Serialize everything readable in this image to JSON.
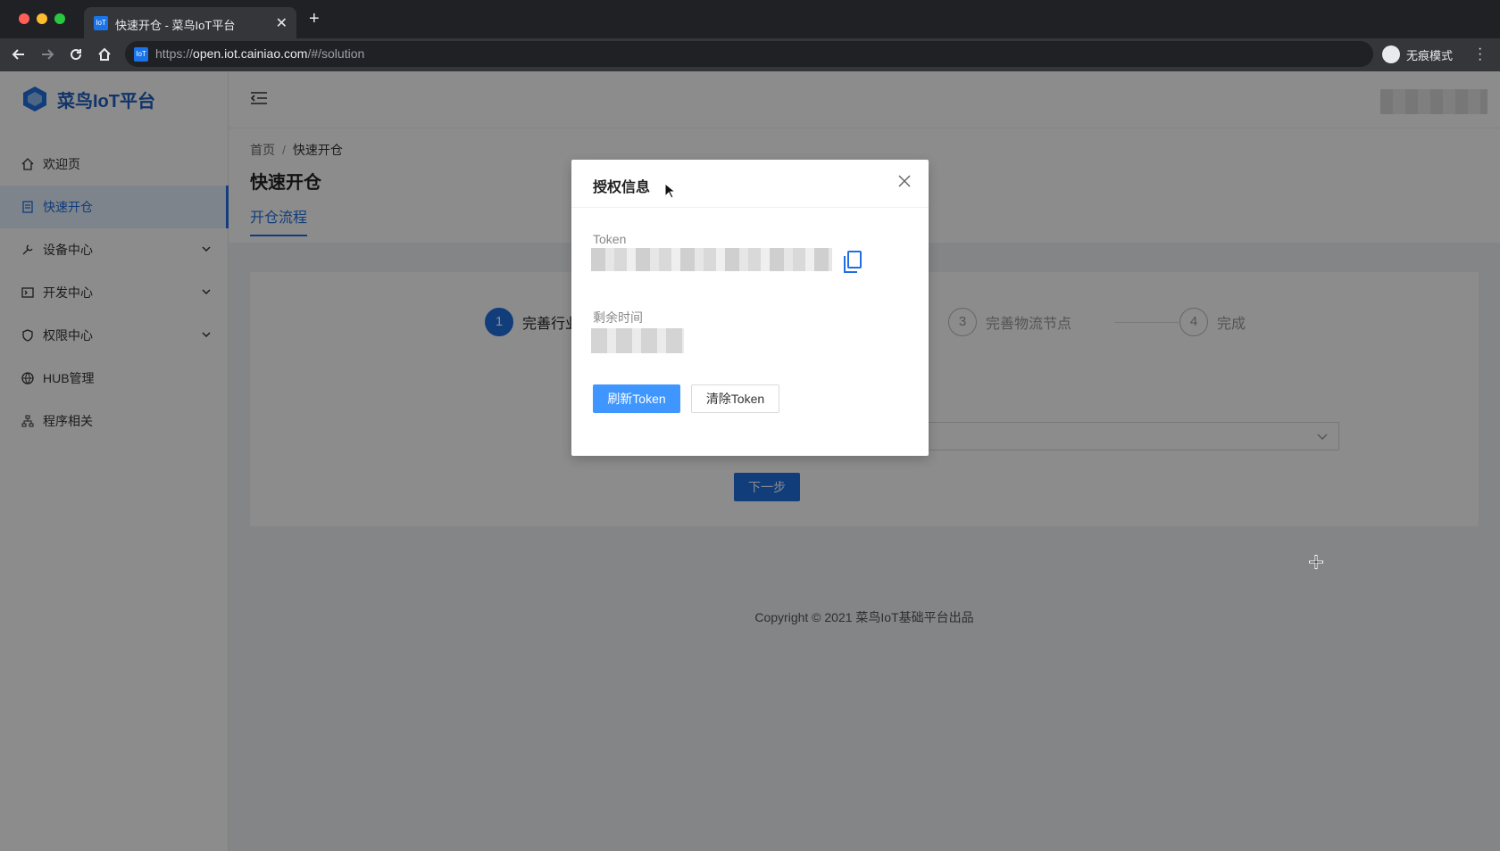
{
  "browser": {
    "tab_favicon": "IoT",
    "tab_title": "快速开仓 - 菜鸟IoT平台",
    "url_prefix": "https://",
    "url_host": "open.iot.cainiao.com",
    "url_path": "/#/solution",
    "incognito_label": "无痕模式"
  },
  "sidebar": {
    "brand": "菜鸟IoT平台",
    "items": [
      {
        "label": "欢迎页",
        "icon": "home-icon"
      },
      {
        "label": "快速开仓",
        "icon": "document-icon",
        "active": true
      },
      {
        "label": "设备中心",
        "icon": "tool-icon",
        "expandable": true
      },
      {
        "label": "开发中心",
        "icon": "code-icon",
        "expandable": true
      },
      {
        "label": "权限中心",
        "icon": "shield-icon",
        "expandable": true
      },
      {
        "label": "HUB管理",
        "icon": "globe-icon"
      },
      {
        "label": "程序相关",
        "icon": "cluster-icon"
      }
    ]
  },
  "page": {
    "breadcrumb_home": "首页",
    "breadcrumb_sep": "/",
    "breadcrumb_current": "快速开仓",
    "title": "快速开仓",
    "tab": "开仓流程",
    "steps": [
      {
        "num": "1",
        "label": "完善行业",
        "active": true
      },
      {
        "num": "3",
        "label": "完善物流节点"
      },
      {
        "num": "4",
        "label": "完成"
      }
    ],
    "next_button": "下一步",
    "copyright": "Copyright © 2021 菜鸟IoT基础平台出品"
  },
  "modal": {
    "title": "授权信息",
    "token_label": "Token",
    "remaining_label": "剩余时间",
    "refresh_button": "刷新Token",
    "clear_button": "清除Token"
  },
  "colors": {
    "primary": "#1f6fe0",
    "modal_primary": "#4096ff"
  }
}
